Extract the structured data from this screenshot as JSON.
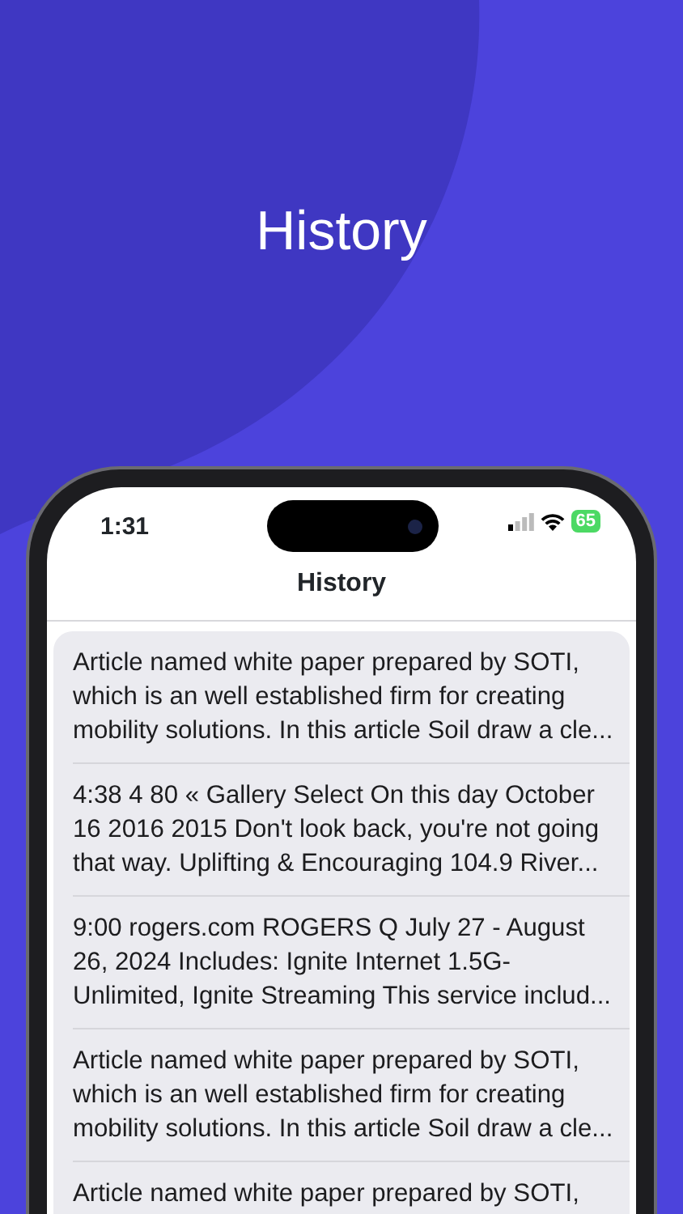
{
  "hero_title": "History",
  "status_bar": {
    "time": "1:31",
    "battery": "65"
  },
  "nav_title": "History",
  "history": [
    {
      "text": "Article named white paper prepared by SOTI, which is an well established firm for creating mobility solutions. In this article Soil draw a cle..."
    },
    {
      "text": "4:38 4 80 « Gallery Select On this day October 16 2016 2015 Don't look back, you're not going that way. Uplifting & Encouraging 104.9 River..."
    },
    {
      "text": "9:00 rogers.com ROGERS Q July 27 - August 26, 2024 Includes: Ignite Internet 1.5G-Unlimited, Ignite Streaming This service includ..."
    },
    {
      "text": "Article named white paper prepared by SOTI, which is an well established firm for creating mobility solutions. In this article Soil draw a cle..."
    },
    {
      "text": "Article named white paper prepared by SOTI,"
    }
  ]
}
